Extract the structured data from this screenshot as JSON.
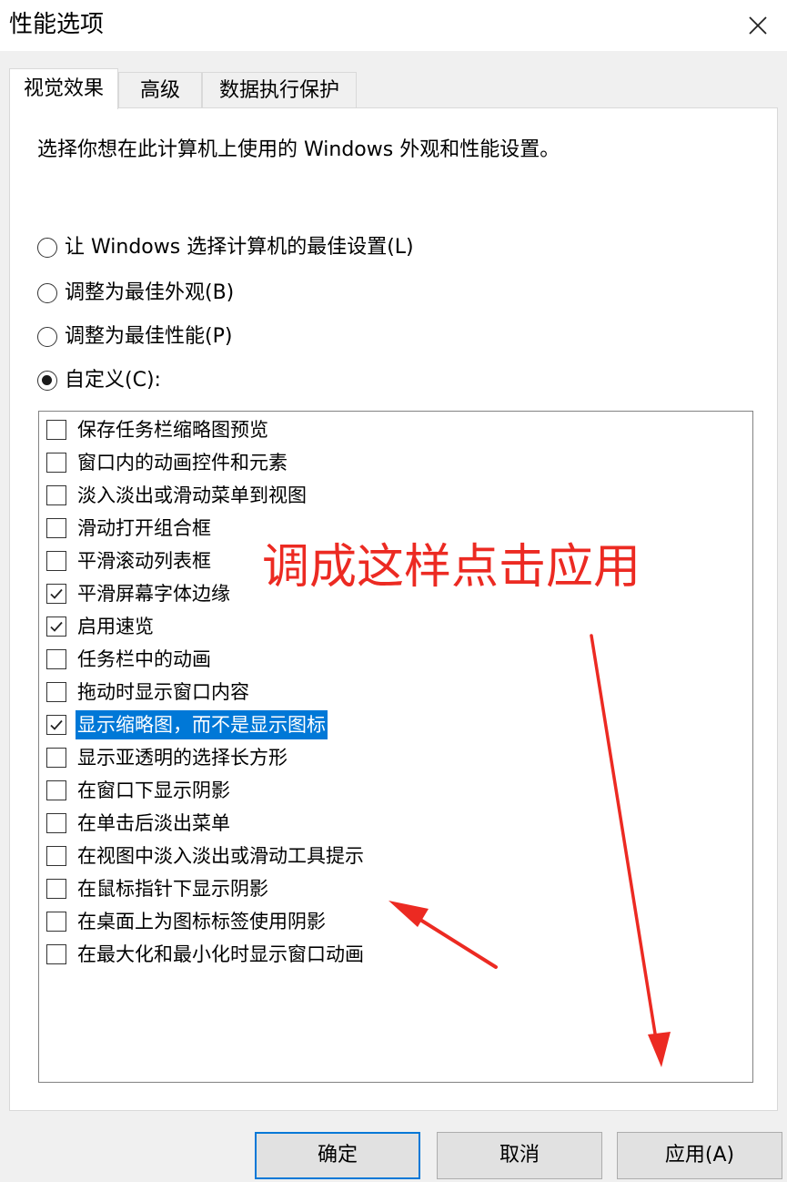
{
  "window": {
    "title": "性能选项"
  },
  "tabs": [
    {
      "label": "视觉效果",
      "active": true
    },
    {
      "label": "高级",
      "active": false
    },
    {
      "label": "数据执行保护",
      "active": false
    }
  ],
  "visual_effects": {
    "intro": "选择你想在此计算机上使用的 Windows 外观和性能设置。",
    "radios": [
      {
        "label": "让 Windows 选择计算机的最佳设置(L)",
        "checked": false
      },
      {
        "label": "调整为最佳外观(B)",
        "checked": false
      },
      {
        "label": "调整为最佳性能(P)",
        "checked": false
      },
      {
        "label": "自定义(C):",
        "checked": true
      }
    ],
    "options": [
      {
        "label": "保存任务栏缩略图预览",
        "checked": false
      },
      {
        "label": "窗口内的动画控件和元素",
        "checked": false
      },
      {
        "label": "淡入淡出或滑动菜单到视图",
        "checked": false
      },
      {
        "label": "滑动打开组合框",
        "checked": false
      },
      {
        "label": "平滑滚动列表框",
        "checked": false
      },
      {
        "label": "平滑屏幕字体边缘",
        "checked": true
      },
      {
        "label": "启用速览",
        "checked": true
      },
      {
        "label": "任务栏中的动画",
        "checked": false
      },
      {
        "label": "拖动时显示窗口内容",
        "checked": false
      },
      {
        "label": "显示缩略图，而不是显示图标",
        "checked": true,
        "selected": true
      },
      {
        "label": "显示亚透明的选择长方形",
        "checked": false
      },
      {
        "label": "在窗口下显示阴影",
        "checked": false
      },
      {
        "label": "在单击后淡出菜单",
        "checked": false
      },
      {
        "label": "在视图中淡入淡出或滑动工具提示",
        "checked": false
      },
      {
        "label": "在鼠标指针下显示阴影",
        "checked": false
      },
      {
        "label": "在桌面上为图标标签使用阴影",
        "checked": false
      },
      {
        "label": "在最大化和最小化时显示窗口动画",
        "checked": false
      }
    ]
  },
  "annotation": {
    "text": "调成这样点击应用",
    "color": "#ec2a22"
  },
  "buttons": {
    "ok": "确定",
    "cancel": "取消",
    "apply": "应用(A)"
  },
  "colors": {
    "selection": "#0078d7",
    "annotation": "#ec2a22"
  }
}
